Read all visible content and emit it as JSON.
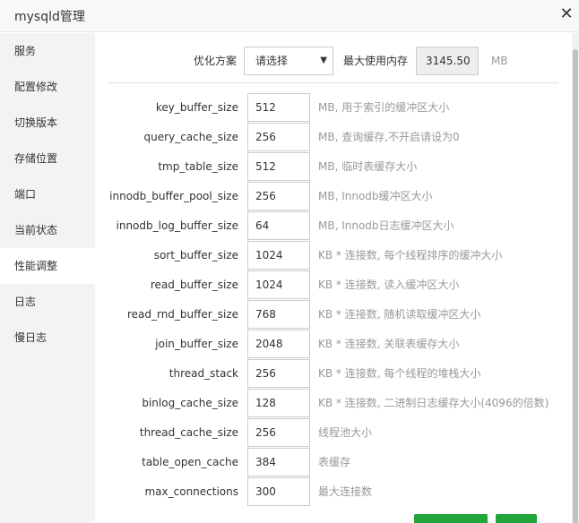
{
  "window": {
    "title": "mysqld管理",
    "close_icon": "close-icon"
  },
  "sidebar": {
    "items": [
      {
        "label": "服务"
      },
      {
        "label": "配置修改"
      },
      {
        "label": "切换版本"
      },
      {
        "label": "存储位置"
      },
      {
        "label": "端口"
      },
      {
        "label": "当前状态"
      },
      {
        "label": "性能调整",
        "active": true
      },
      {
        "label": "日志"
      },
      {
        "label": "慢日志"
      }
    ]
  },
  "optimize": {
    "label": "优化方案",
    "select_value": "请选择",
    "max_mem_label": "最大使用内存",
    "max_mem_value": "3145.50",
    "max_mem_unit": "MB"
  },
  "params": [
    {
      "name": "key_buffer_size",
      "value": "512",
      "desc": "MB, 用于索引的缓冲区大小"
    },
    {
      "name": "query_cache_size",
      "value": "256",
      "desc": "MB, 查询缓存,不开启请设为0"
    },
    {
      "name": "tmp_table_size",
      "value": "512",
      "desc": "MB, 临时表缓存大小"
    },
    {
      "name": "innodb_buffer_pool_size",
      "value": "256",
      "desc": "MB, Innodb缓冲区大小"
    },
    {
      "name": "innodb_log_buffer_size",
      "value": "64",
      "desc": "MB, Innodb日志缓冲区大小"
    },
    {
      "name": "sort_buffer_size",
      "value": "1024",
      "desc": "KB * 连接数, 每个线程排序的缓冲大小"
    },
    {
      "name": "read_buffer_size",
      "value": "1024",
      "desc": "KB * 连接数, 读入缓冲区大小"
    },
    {
      "name": "read_rnd_buffer_size",
      "value": "768",
      "desc": "KB * 连接数, 随机读取缓冲区大小"
    },
    {
      "name": "join_buffer_size",
      "value": "2048",
      "desc": "KB * 连接数, 关联表缓存大小"
    },
    {
      "name": "thread_stack",
      "value": "256",
      "desc": "KB * 连接数, 每个线程的堆栈大小"
    },
    {
      "name": "binlog_cache_size",
      "value": "128",
      "desc": "KB * 连接数, 二进制日志缓存大小(4096的倍数)"
    },
    {
      "name": "thread_cache_size",
      "value": "256",
      "desc": "线程池大小"
    },
    {
      "name": "table_open_cache",
      "value": "384",
      "desc": "表缓存"
    },
    {
      "name": "max_connections",
      "value": "300",
      "desc": "最大连接数"
    }
  ],
  "colors": {
    "accent": "#20a53a",
    "sidebar_bg": "#f3f3f3",
    "muted_text": "#999999"
  }
}
